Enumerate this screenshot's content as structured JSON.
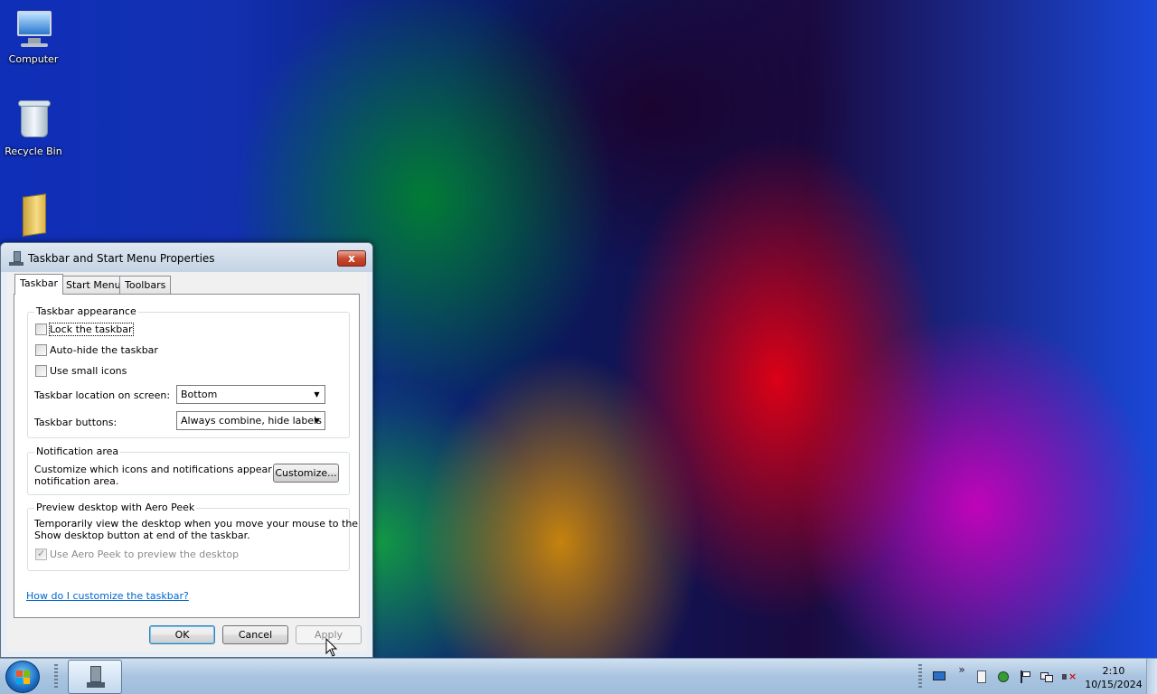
{
  "desktop": {
    "icons": [
      {
        "label": "Computer",
        "icon": "computer-icon"
      },
      {
        "label": "Recycle Bin",
        "icon": "recycle-bin-icon"
      },
      {
        "label": "",
        "icon": "folder-icon"
      }
    ]
  },
  "dialog": {
    "title": "Taskbar and Start Menu Properties",
    "close_label": "x",
    "tabs": [
      {
        "label": "Taskbar",
        "active": true
      },
      {
        "label": "Start Menu",
        "active": false
      },
      {
        "label": "Toolbars",
        "active": false
      }
    ],
    "appearance": {
      "group_title": "Taskbar appearance",
      "lock_taskbar": {
        "label": "Lock the taskbar",
        "checked": false
      },
      "auto_hide": {
        "label": "Auto-hide the taskbar",
        "checked": false
      },
      "small_icons": {
        "label": "Use small icons",
        "checked": false
      },
      "location_label": "Taskbar location on screen:",
      "location_value": "Bottom",
      "buttons_label": "Taskbar buttons:",
      "buttons_value": "Always combine, hide labels"
    },
    "notification": {
      "group_title": "Notification area",
      "description_line1": "Customize which icons and notifications appear in the",
      "description_line2": "notification area.",
      "customize_button": "Customize..."
    },
    "aero_peek": {
      "group_title": "Preview desktop with Aero Peek",
      "description_line1": "Temporarily view the desktop when you move your mouse to the",
      "description_line2": "Show desktop button at end of the taskbar.",
      "checkbox_label": "Use Aero Peek to preview the desktop",
      "checked": true,
      "disabled": true
    },
    "help_link": "How do I customize the taskbar?",
    "buttons": {
      "ok": "OK",
      "cancel": "Cancel",
      "apply": "Apply"
    }
  },
  "taskbar": {
    "clock_time": "2:10",
    "clock_date": "10/15/2024",
    "tray_overflow": "»",
    "tray_icons": [
      "monitor-icon",
      "document-icon",
      "security-icon",
      "action-center-flag-icon",
      "network-icon",
      "volume-muted-icon"
    ]
  },
  "colors": {
    "link": "#0066cc",
    "close_button": "#c84a32",
    "taskbar": "#a9c4e0"
  }
}
